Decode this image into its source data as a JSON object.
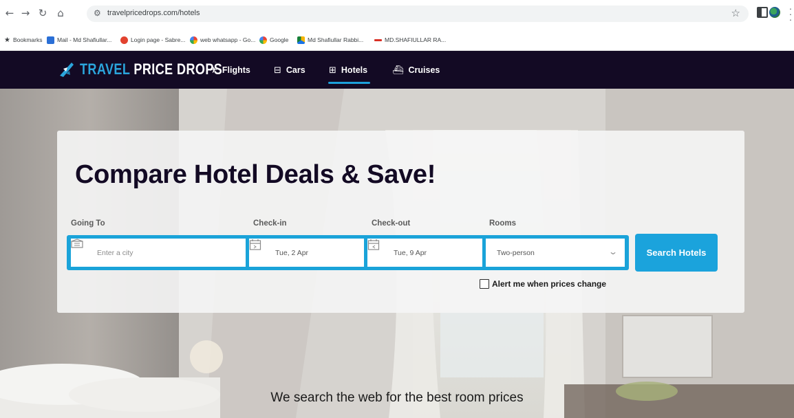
{
  "browser": {
    "url": "travelpricedrops.com/hotels",
    "nav_icons": [
      "back-arrow-icon",
      "forward-arrow-icon",
      "reload-icon",
      "home-icon"
    ]
  },
  "bookmarks": [
    {
      "label": "Bookmarks",
      "icon": "star-icon",
      "color": "#3c4043"
    },
    {
      "label": "Mail - Md Shafiullar...",
      "icon": "mail-icon",
      "color": "#2a6fd6"
    },
    {
      "label": "Login page - Sabre...",
      "icon": "sabre-icon",
      "color": "#e2422f"
    },
    {
      "label": "web whatsapp - Go...",
      "icon": "google-icon",
      "color": "#4285f4"
    },
    {
      "label": "Google",
      "icon": "google-icon",
      "color": "#4285f4"
    },
    {
      "label": "Md Shafiullar Rabbi...",
      "icon": "drive-icon",
      "color": "#f5b400"
    },
    {
      "label": "MD.SHAFIULLAR RA...",
      "icon": "dash-icon",
      "color": "#d93025"
    }
  ],
  "site": {
    "logo": {
      "part1": "TRAVEL",
      "part2": "PRICE DROPS"
    },
    "nav": [
      {
        "label": "Flights",
        "icon": "plane-icon",
        "active": false
      },
      {
        "label": "Cars",
        "icon": "car-icon",
        "active": false
      },
      {
        "label": "Hotels",
        "icon": "hotel-icon",
        "active": true
      },
      {
        "label": "Cruises",
        "icon": "ship-icon",
        "active": false
      }
    ],
    "colors": {
      "nav_bg": "#130a24",
      "accent": "#1ba3dc",
      "headline": "#130a24"
    }
  },
  "search": {
    "headline": "Compare Hotel Deals & Save!",
    "going_to": {
      "label": "Going To",
      "placeholder": "Enter a city"
    },
    "check_in": {
      "label": "Check-in",
      "value": "Tue, 2 Apr"
    },
    "check_out": {
      "label": "Check-out",
      "value": "Tue, 9 Apr"
    },
    "rooms": {
      "label": "Rooms",
      "value": "Two-person"
    },
    "button": "Search Hotels",
    "alert_label": "Alert me when prices change",
    "alert_checked": false
  },
  "tagline": "We search the web for the best room prices"
}
